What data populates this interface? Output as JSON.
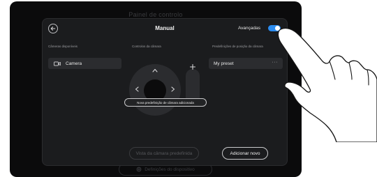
{
  "background_title": "Painel de controlo",
  "background_footer": "Definições do dispositivo",
  "header": {
    "title": "Manual",
    "advanced_label": "Avançadas",
    "advanced_on": true
  },
  "columns": {
    "cameras_label": "Câmeras disponíveis",
    "controls_label": "Controlos da câmara",
    "presets_label": "Predefinições de posição da câmara"
  },
  "cameras": [
    {
      "label": "Camera"
    }
  ],
  "presets": [
    {
      "label": "My preset",
      "menu": "···"
    }
  ],
  "toast": "Nova predefinição de câmara adicionada",
  "buttons": {
    "default_view": "Vista da câmara predefinida",
    "add_new": "Adicionar novo"
  },
  "colors": {
    "accent": "#2b8cf0",
    "panel": "#1b1c1e",
    "device": "#0b0b0c"
  }
}
